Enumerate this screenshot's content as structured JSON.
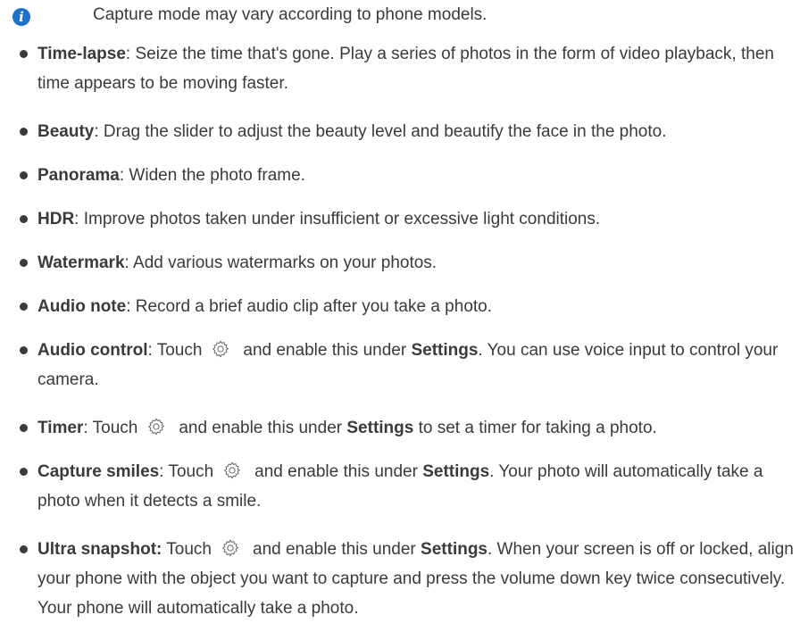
{
  "note": {
    "icon": "info-icon",
    "text": "Capture mode may vary according to phone models."
  },
  "modes": [
    {
      "term": "Time-lapse",
      "sep": ":",
      "text": " Seize the time that's gone. Play a series of photos in the form of video playback, then time appears to be moving faster."
    },
    {
      "term": "Beauty",
      "sep": ":",
      "text": " Drag the slider to adjust the beauty level and beautify the face in the photo."
    },
    {
      "term": "Panorama",
      "sep": ":",
      "text": " Widen the photo frame."
    },
    {
      "term": "HDR",
      "sep": ":",
      "text": " Improve photos taken under insufficient or excessive light conditions."
    },
    {
      "term": "Watermark",
      "sep": ":",
      "text": " Add various watermarks on your photos."
    },
    {
      "term": "Audio note",
      "sep": ":",
      "text": " Record a brief audio clip after you take a photo."
    },
    {
      "term": "Audio control",
      "sep": ":",
      "pre": " Touch",
      "mid": "and enable this under ",
      "settings": "Settings",
      "post": ". You can use voice input to control your camera."
    },
    {
      "term": "Timer",
      "sep": ":",
      "pre": " Touch",
      "mid": "and enable this under ",
      "settings": "Settings",
      "post": " to set a timer for taking a photo."
    },
    {
      "term": "Capture smiles",
      "sep": ":",
      "pre": " Touch",
      "mid": "and enable this under ",
      "settings": "Settings",
      "post": ". Your photo will automatically take a photo when it detects a smile."
    },
    {
      "term": "Ultra snapshot:",
      "sep": "",
      "pre": " Touch",
      "mid": "and enable this under ",
      "settings": "Settings",
      "post": ". When your screen is off or locked, align your phone with the object you want to capture and press the volume down key twice consecutively. Your phone will automatically take a photo."
    }
  ]
}
